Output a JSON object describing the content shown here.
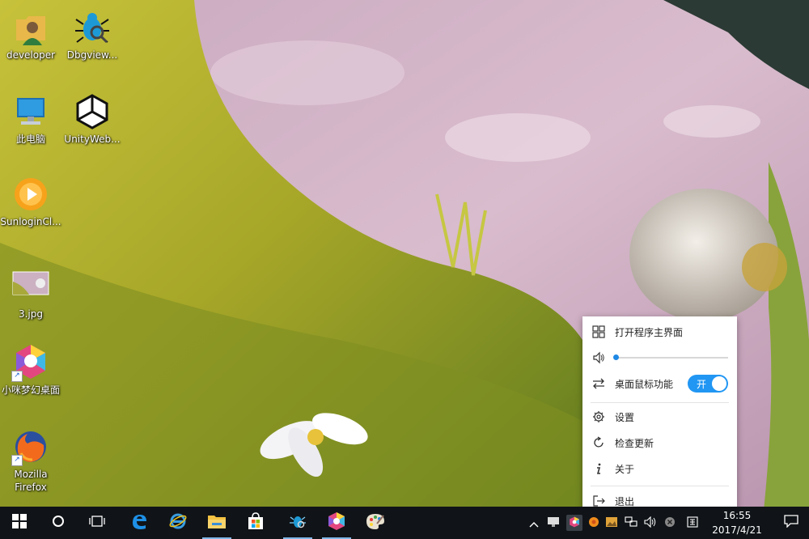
{
  "desktop": {
    "icons": [
      {
        "label": "developer"
      },
      {
        "label": "Dbgview..."
      },
      {
        "label": "此电脑"
      },
      {
        "label": "UnityWeb..."
      },
      {
        "label": "SunloginCl..."
      },
      {
        "label": "3.jpg"
      },
      {
        "label": "小咪梦幻桌面"
      },
      {
        "label": "Mozilla\nFirefox"
      }
    ]
  },
  "context_menu": {
    "open_main": "打开程序主界面",
    "volume_level": 0.0,
    "desktop_mouse": "桌面鼠标功能",
    "toggle_label": "开",
    "toggle_on": true,
    "settings": "设置",
    "check_update": "检查更新",
    "about": "关于",
    "exit": "退出"
  },
  "taskbar": {
    "apps": [
      "windows-start",
      "cortana",
      "task-view",
      "edge",
      "internet-explorer",
      "file-explorer",
      "store",
      "dbgview",
      "dream-desktop",
      "paint"
    ],
    "tray_icons": [
      "show-hidden",
      "network-monitor",
      "dream-desktop-tray",
      "orange-tray",
      "image-tray",
      "network",
      "volume",
      "close-tray",
      "input-method"
    ],
    "clock_time": "16:55",
    "clock_date": "2017/4/21"
  },
  "colors": {
    "accent": "#2196f3",
    "taskbar": "#101418"
  }
}
